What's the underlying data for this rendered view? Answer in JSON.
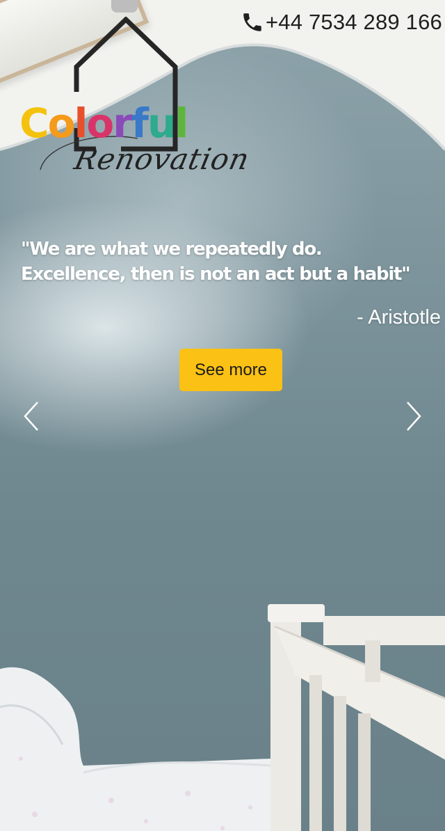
{
  "header": {
    "phone_number": "+44 7534 289 166",
    "phone_icon": "phone-icon"
  },
  "logo": {
    "word_letters": [
      "C",
      "o",
      "l",
      "o",
      "r",
      "f",
      "u",
      "l"
    ],
    "script_text": "Renovation",
    "house_icon": "house-outline-icon"
  },
  "hero": {
    "quote_lines": [
      "\"We are what we repeatedly do.",
      "Excellence, then is not an act but a habit\""
    ],
    "author": "- Aristotle",
    "cta_label": "See more",
    "prev_icon": "chevron-left-icon",
    "next_icon": "chevron-right-icon"
  },
  "colors": {
    "cta": "#fbc114",
    "quote_text": "#ffffff",
    "logo_letters": [
      "#f4c20d",
      "#f59a1a",
      "#e8502c",
      "#d8346a",
      "#8a4bb8",
      "#3a78c8",
      "#2eaa8e",
      "#5cb63a"
    ]
  }
}
